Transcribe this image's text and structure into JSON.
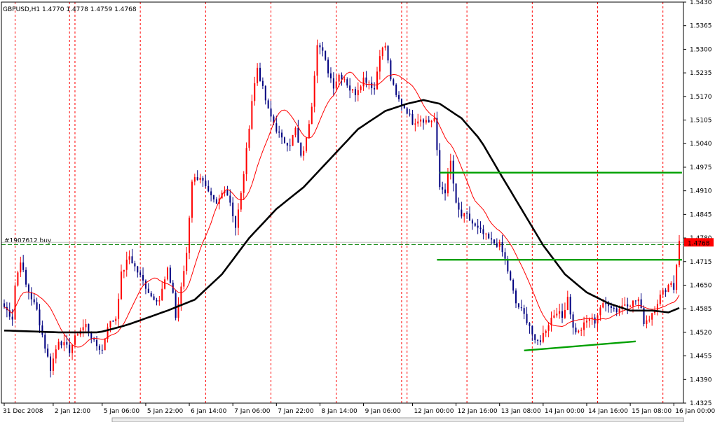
{
  "chart_data": {
    "type": "candlestick",
    "title": "GBPUSD,H1  1.4770 1.4778 1.4759 1.4768",
    "ylim": [
      1.4325,
      1.543
    ],
    "y_ticks": [
      "1.5430",
      "1.5365",
      "1.5300",
      "1.5235",
      "1.5170",
      "1.5105",
      "1.5040",
      "1.4975",
      "1.4910",
      "1.4845",
      "1.4780",
      "1.4715",
      "1.4650",
      "1.4585",
      "1.4520",
      "1.4455",
      "1.4390",
      "1.4325"
    ],
    "x_ticks": [
      {
        "label": "31 Dec 2008",
        "t": 0
      },
      {
        "label": "2 Jan 12:00",
        "t": 18
      },
      {
        "label": "5 Jan 06:00",
        "t": 36
      },
      {
        "label": "5 Jan 22:00",
        "t": 52
      },
      {
        "label": "6 Jan 14:00",
        "t": 68
      },
      {
        "label": "7 Jan 06:00",
        "t": 84
      },
      {
        "label": "7 Jan 22:00",
        "t": 100
      },
      {
        "label": "8 Jan 14:00",
        "t": 116
      },
      {
        "label": "9 Jan 06:00",
        "t": 132
      },
      {
        "label": "12 Jan 00:00",
        "t": 150
      },
      {
        "label": "12 Jan 16:00",
        "t": 166
      },
      {
        "label": "13 Jan 08:00",
        "t": 182
      },
      {
        "label": "14 Jan 00:00",
        "t": 198
      },
      {
        "label": "14 Jan 16:00",
        "t": 214
      },
      {
        "label": "15 Jan 08:00",
        "t": 230
      },
      {
        "label": "16 Jan 00:00",
        "t": 246
      }
    ],
    "bar_count": 249,
    "day_separators_t": [
      4,
      24,
      26,
      50,
      74,
      98,
      122,
      146,
      148,
      170,
      194,
      218,
      242
    ],
    "price_path": [
      [
        0,
        1.459
      ],
      [
        3,
        1.456
      ],
      [
        4,
        1.465
      ],
      [
        6,
        1.472
      ],
      [
        8,
        1.465
      ],
      [
        12,
        1.458
      ],
      [
        15,
        1.448
      ],
      [
        17,
        1.442
      ],
      [
        20,
        1.45
      ],
      [
        24,
        1.447
      ],
      [
        27,
        1.452
      ],
      [
        30,
        1.454
      ],
      [
        33,
        1.449
      ],
      [
        36,
        1.447
      ],
      [
        38,
        1.454
      ],
      [
        41,
        1.456
      ],
      [
        43,
        1.468
      ],
      [
        46,
        1.473
      ],
      [
        48,
        1.47
      ],
      [
        51,
        1.466
      ],
      [
        54,
        1.462
      ],
      [
        57,
        1.461
      ],
      [
        60,
        1.469
      ],
      [
        62,
        1.463
      ],
      [
        63,
        1.456
      ],
      [
        65,
        1.464
      ],
      [
        67,
        1.474
      ],
      [
        69,
        1.494
      ],
      [
        72,
        1.495
      ],
      [
        75,
        1.49
      ],
      [
        78,
        1.487
      ],
      [
        81,
        1.492
      ],
      [
        83,
        1.488
      ],
      [
        85,
        1.481
      ],
      [
        87,
        1.49
      ],
      [
        89,
        1.502
      ],
      [
        91,
        1.516
      ],
      [
        93,
        1.525
      ],
      [
        95,
        1.519
      ],
      [
        97,
        1.513
      ],
      [
        100,
        1.508
      ],
      [
        102,
        1.505
      ],
      [
        105,
        1.504
      ],
      [
        107,
        1.508
      ],
      [
        109,
        1.5
      ],
      [
        111,
        1.505
      ],
      [
        113,
        1.515
      ],
      [
        115,
        1.532
      ],
      [
        117,
        1.529
      ],
      [
        119,
        1.524
      ],
      [
        121,
        1.52
      ],
      [
        123,
        1.523
      ],
      [
        125,
        1.522
      ],
      [
        127,
        1.519
      ],
      [
        129,
        1.518
      ],
      [
        132,
        1.522
      ],
      [
        134,
        1.521
      ],
      [
        136,
        1.519
      ],
      [
        138,
        1.529
      ],
      [
        140,
        1.531
      ],
      [
        142,
        1.522
      ],
      [
        144,
        1.517
      ],
      [
        146,
        1.515
      ],
      [
        148,
        1.513
      ],
      [
        150,
        1.51
      ],
      [
        153,
        1.511
      ],
      [
        156,
        1.51
      ],
      [
        158,
        1.511
      ],
      [
        160,
        1.492
      ],
      [
        162,
        1.491
      ],
      [
        164,
        1.499
      ],
      [
        166,
        1.487
      ],
      [
        168,
        1.484
      ],
      [
        170,
        1.484
      ],
      [
        173,
        1.481
      ],
      [
        176,
        1.479
      ],
      [
        179,
        1.477
      ],
      [
        182,
        1.476
      ],
      [
        184,
        1.472
      ],
      [
        186,
        1.466
      ],
      [
        188,
        1.46
      ],
      [
        190,
        1.458
      ],
      [
        193,
        1.454
      ],
      [
        195,
        1.449
      ],
      [
        197,
        1.45
      ],
      [
        199,
        1.453
      ],
      [
        201,
        1.456
      ],
      [
        203,
        1.458
      ],
      [
        205,
        1.456
      ],
      [
        207,
        1.462
      ],
      [
        209,
        1.453
      ],
      [
        211,
        1.452
      ],
      [
        213,
        1.454
      ],
      [
        215,
        1.456
      ],
      [
        217,
        1.455
      ],
      [
        219,
        1.459
      ],
      [
        222,
        1.46
      ],
      [
        225,
        1.458
      ],
      [
        228,
        1.46
      ],
      [
        230,
        1.46
      ],
      [
        233,
        1.461
      ],
      [
        235,
        1.455
      ],
      [
        237,
        1.456
      ],
      [
        239,
        1.459
      ],
      [
        241,
        1.462
      ],
      [
        243,
        1.464
      ],
      [
        245,
        1.466
      ],
      [
        246,
        1.464
      ],
      [
        247,
        1.471
      ],
      [
        248,
        1.4768
      ]
    ],
    "ema_slow": [
      [
        0,
        1.4525
      ],
      [
        20,
        1.452
      ],
      [
        35,
        1.452
      ],
      [
        45,
        1.454
      ],
      [
        60,
        1.458
      ],
      [
        70,
        1.461
      ],
      [
        80,
        1.468
      ],
      [
        90,
        1.478
      ],
      [
        100,
        1.486
      ],
      [
        110,
        1.492
      ],
      [
        120,
        1.5
      ],
      [
        130,
        1.508
      ],
      [
        140,
        1.513
      ],
      [
        148,
        1.515
      ],
      [
        154,
        1.516
      ],
      [
        160,
        1.515
      ],
      [
        168,
        1.511
      ],
      [
        175,
        1.505
      ],
      [
        182,
        1.496
      ],
      [
        190,
        1.486
      ],
      [
        198,
        1.476
      ],
      [
        206,
        1.468
      ],
      [
        214,
        1.463
      ],
      [
        222,
        1.46
      ],
      [
        230,
        1.458
      ],
      [
        238,
        1.458
      ],
      [
        244,
        1.4575
      ],
      [
        249,
        1.459
      ]
    ],
    "ema_fast_color": "#ff0000",
    "ema_slow_color": "#000000",
    "bull_color": "#ff0000",
    "bear_color": "#000080",
    "support_resistance": [
      {
        "t1": 160,
        "p1": 1.496,
        "t2": 249,
        "p2": 1.496,
        "color": "#00a000"
      },
      {
        "t1": 159,
        "p1": 1.472,
        "t2": 249,
        "p2": 1.472,
        "color": "#00a000"
      },
      {
        "t1": 191,
        "p1": 1.447,
        "t2": 232,
        "p2": 1.4495,
        "color": "#00a000"
      }
    ],
    "order": {
      "label": "#1907612 buy",
      "price": 1.4762,
      "color": "#008000"
    },
    "current_price": {
      "label": "1.4768",
      "price": 1.4768,
      "color": "#ff0000"
    },
    "grid": false
  }
}
